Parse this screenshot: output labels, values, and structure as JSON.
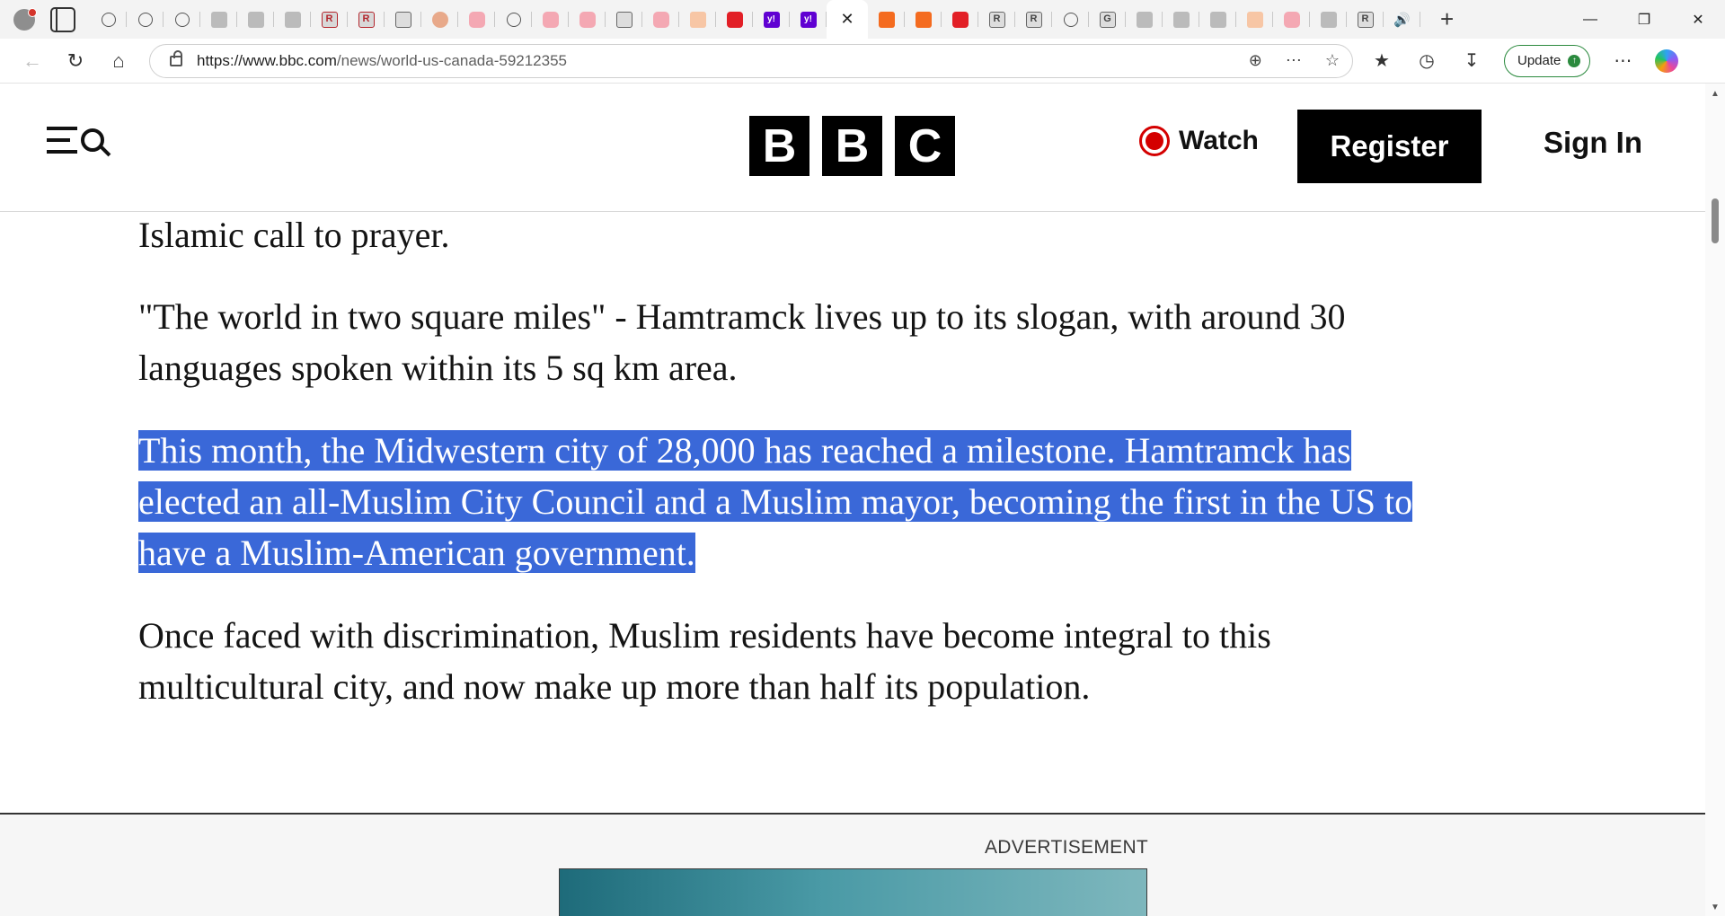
{
  "browser": {
    "tabs": [
      {
        "icon": "globe-icon",
        "kind": "globe"
      },
      {
        "icon": "globe-icon",
        "kind": "globe"
      },
      {
        "icon": "globe-icon",
        "kind": "globe"
      },
      {
        "icon": "news-site-icon",
        "kind": "gray"
      },
      {
        "icon": "folder-icon",
        "kind": "gray"
      },
      {
        "icon": "arrow-icon",
        "kind": "gray"
      },
      {
        "icon": "realtoday-icon",
        "kind": "rtoday",
        "glyph": "R"
      },
      {
        "icon": "realtoday-icon",
        "kind": "rtoday",
        "glyph": "R"
      },
      {
        "icon": "pdf-icon",
        "kind": "rdark"
      },
      {
        "icon": "circle-site-icon",
        "kind": "salmon"
      },
      {
        "icon": "youtube-faded-icon",
        "kind": "pink"
      },
      {
        "icon": "wiki-icon",
        "kind": "globe"
      },
      {
        "icon": "youtube-faded-icon",
        "kind": "pink"
      },
      {
        "icon": "youtube-faded-icon",
        "kind": "pink"
      },
      {
        "icon": "pdf-icon",
        "kind": "rdark"
      },
      {
        "icon": "youtube-faded-icon",
        "kind": "pink"
      },
      {
        "icon": "blogger-faded-icon",
        "kind": "peach"
      },
      {
        "icon": "youtube-icon",
        "kind": "red"
      },
      {
        "icon": "yahoo-icon",
        "kind": "yahoo",
        "glyph": "y!"
      },
      {
        "icon": "yahoo-icon",
        "kind": "yahoo",
        "glyph": "y!"
      },
      {
        "icon": "close-icon",
        "kind": "active"
      },
      {
        "icon": "blogger-icon",
        "kind": "orange"
      },
      {
        "icon": "blogger-icon",
        "kind": "orange"
      },
      {
        "icon": "youtube-icon",
        "kind": "red"
      },
      {
        "icon": "r-site-icon",
        "kind": "rdark",
        "glyph": "R"
      },
      {
        "icon": "r-site-icon",
        "kind": "rdark",
        "glyph": "R"
      },
      {
        "icon": "search-icon",
        "kind": "globe"
      },
      {
        "icon": "gr-icon",
        "kind": "rdark",
        "glyph": "G"
      },
      {
        "icon": "image-icon",
        "kind": "gray"
      },
      {
        "icon": "image-icon",
        "kind": "gray"
      },
      {
        "icon": "image-icon",
        "kind": "gray"
      },
      {
        "icon": "blogger-faded-icon",
        "kind": "peach"
      },
      {
        "icon": "youtube-faded-icon",
        "kind": "pink"
      },
      {
        "icon": "image-icon",
        "kind": "gray"
      },
      {
        "icon": "r-site-icon",
        "kind": "rdark",
        "glyph": "R"
      },
      {
        "icon": "speaker-icon",
        "kind": "speaker"
      }
    ],
    "url_host": "https://www.bbc.com",
    "url_path": "/news/world-us-canada-59212355",
    "update_label": "Update",
    "accent": "#2b8a3e"
  },
  "header": {
    "logo": [
      "B",
      "B",
      "C"
    ],
    "watch_label": "Watch",
    "register_label": "Register",
    "signin_label": "Sign In"
  },
  "article": {
    "p1": "Islamic call to prayer.",
    "p2_line1": "\"The world in two square miles\" - Hamtramck lives up to its slogan, with around 30",
    "p2_line2": "languages spoken within its 5 sq km area.",
    "p3_line1": "This month, the Midwestern city of 28,000 has reached a milestone. Hamtramck has",
    "p3_line2": "elected an all-Muslim City Council and a Muslim mayor, becoming the first in the US to",
    "p3_line3": "have a Muslim-American government.",
    "p4_line1": "Once faced with discrimination, Muslim residents have become integral to this",
    "p4_line2": "multicultural city, and now make up more than half its population.",
    "highlight_color": "#3a68d8"
  },
  "ad": {
    "label": "ADVERTISEMENT"
  }
}
